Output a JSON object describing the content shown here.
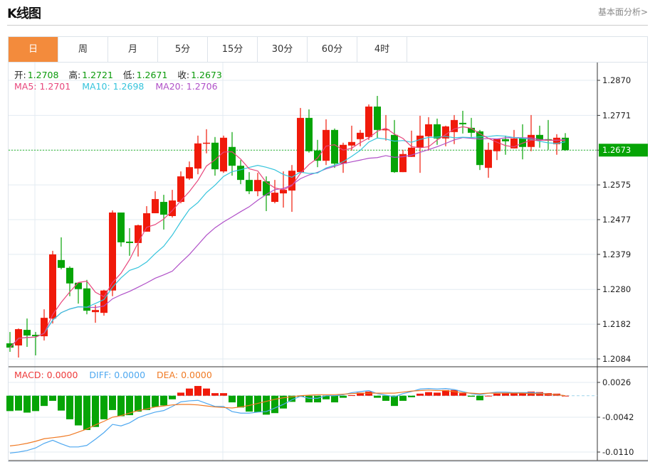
{
  "header": {
    "title": "K线图",
    "fundamental_link": "基本面分析>"
  },
  "tabs": [
    {
      "label": "日",
      "active": true
    },
    {
      "label": "周"
    },
    {
      "label": "月"
    },
    {
      "label": "5分"
    },
    {
      "label": "15分"
    },
    {
      "label": "30分"
    },
    {
      "label": "60分"
    },
    {
      "label": "4时"
    }
  ],
  "legend": {
    "open_label": "开:",
    "open": "1.2708",
    "high_label": "高:",
    "high": "1.2721",
    "low_label": "低:",
    "low": "1.2671",
    "close_label": "收:",
    "close": "1.2673",
    "ma5": "MA5: 1.2701",
    "ma10": "MA10: 1.2698",
    "ma20": "MA20: 1.2706",
    "macd": "MACD: 0.0000",
    "diff": "DIFF: 0.0000",
    "dea": "DEA: 0.0000"
  },
  "colors": {
    "up": "#f01a0a",
    "down": "#06a406",
    "ma5": "#e8467c",
    "ma10": "#35c4dc",
    "ma20": "#b050c8",
    "diff": "#4ea8f0",
    "dea": "#f07a24",
    "accent": "#f38b3c"
  },
  "chart_data": {
    "type": "candlestick",
    "price_axis": {
      "ticks": [
        "1.2870",
        "1.2771",
        "1.2673",
        "1.2575",
        "1.2477",
        "1.2379",
        "1.2280",
        "1.2182",
        "1.2084"
      ],
      "range": [
        1.2084,
        1.287
      ]
    },
    "last_price": "1.2673",
    "macd_axis": {
      "ticks": [
        "0.0026",
        "-0.0042",
        "-0.0110"
      ],
      "range": [
        -0.011,
        0.0026
      ]
    },
    "ohlc": [
      [
        1.2128,
        1.216,
        1.2104,
        1.2116
      ],
      [
        1.2122,
        1.217,
        1.2088,
        1.2168
      ],
      [
        1.2166,
        1.2198,
        1.2118,
        1.215
      ],
      [
        1.2152,
        1.216,
        1.2094,
        1.2148
      ],
      [
        1.2148,
        1.2224,
        1.2136,
        1.22
      ],
      [
        1.2198,
        1.2389,
        1.2184,
        1.2379
      ],
      [
        1.2363,
        1.2427,
        1.2337,
        1.2341
      ],
      [
        1.2341,
        1.2345,
        1.2261,
        1.2297
      ],
      [
        1.2299,
        1.2299,
        1.224,
        1.2281
      ],
      [
        1.2283,
        1.2307,
        1.221,
        1.222
      ],
      [
        1.2216,
        1.2236,
        1.2186,
        1.2222
      ],
      [
        1.2214,
        1.2279,
        1.2206,
        1.2277
      ],
      [
        1.2277,
        1.2503,
        1.2261,
        1.2497
      ],
      [
        1.2497,
        1.2497,
        1.2401,
        1.2413
      ],
      [
        1.2415,
        1.2453,
        1.2375,
        1.2411
      ],
      [
        1.2411,
        1.2463,
        1.2373,
        1.2461
      ],
      [
        1.2443,
        1.2515,
        1.2443,
        1.2495
      ],
      [
        1.2495,
        1.2557,
        1.2495,
        1.2535
      ],
      [
        1.2527,
        1.2547,
        1.2449,
        1.2491
      ],
      [
        1.2487,
        1.2561,
        1.2483,
        1.2531
      ],
      [
        1.2527,
        1.2613,
        1.2523,
        1.2599
      ],
      [
        1.2593,
        1.2641,
        1.2589,
        1.2625
      ],
      [
        1.2621,
        1.2714,
        1.2605,
        1.2692
      ],
      [
        1.2692,
        1.2732,
        1.2664,
        1.2694
      ],
      [
        1.2694,
        1.271,
        1.2601,
        1.2619
      ],
      [
        1.2613,
        1.2714,
        1.2609,
        1.2708
      ],
      [
        1.2682,
        1.2724,
        1.2601,
        1.2629
      ],
      [
        1.2629,
        1.2645,
        1.2577,
        1.2589
      ],
      [
        1.2589,
        1.2611,
        1.2549,
        1.2557
      ],
      [
        1.2557,
        1.2609,
        1.2543,
        1.2589
      ],
      [
        1.2585,
        1.2599,
        1.2501,
        1.2545
      ],
      [
        1.2527,
        1.2589,
        1.2523,
        1.2553
      ],
      [
        1.2551,
        1.2613,
        1.2511,
        1.2561
      ],
      [
        1.2559,
        1.2631,
        1.2499,
        1.2615
      ],
      [
        1.2611,
        1.2792,
        1.2609,
        1.2764
      ],
      [
        1.2764,
        1.2788,
        1.2666,
        1.267
      ],
      [
        1.2672,
        1.2702,
        1.2625,
        1.2643
      ],
      [
        1.2643,
        1.276,
        1.2631,
        1.273
      ],
      [
        1.273,
        1.2734,
        1.2623,
        1.2635
      ],
      [
        1.2635,
        1.2694,
        1.2609,
        1.2688
      ],
      [
        1.2686,
        1.2742,
        1.2672,
        1.2696
      ],
      [
        1.2704,
        1.273,
        1.2684,
        1.2722
      ],
      [
        1.271,
        1.2802,
        1.2702,
        1.2796
      ],
      [
        1.2796,
        1.2826,
        1.2706,
        1.273
      ],
      [
        1.273,
        1.2772,
        1.27,
        1.2732
      ],
      [
        1.2716,
        1.2758,
        1.2609,
        1.2611
      ],
      [
        1.2611,
        1.2674,
        1.2611,
        1.2662
      ],
      [
        1.2654,
        1.2728,
        1.2654,
        1.268
      ],
      [
        1.268,
        1.277,
        1.2609,
        1.2714
      ],
      [
        1.2712,
        1.2766,
        1.2672,
        1.2746
      ],
      [
        1.2746,
        1.2762,
        1.2688,
        1.2706
      ],
      [
        1.2706,
        1.2742,
        1.2684,
        1.274
      ],
      [
        1.2724,
        1.2772,
        1.269,
        1.2758
      ],
      [
        1.275,
        1.2784,
        1.272,
        1.2746
      ],
      [
        1.2736,
        1.2764,
        1.271,
        1.2722
      ],
      [
        1.2726,
        1.273,
        1.2617,
        1.2631
      ],
      [
        1.2623,
        1.2694,
        1.2595,
        1.2674
      ],
      [
        1.267,
        1.2704,
        1.2645,
        1.2704
      ],
      [
        1.2704,
        1.2714,
        1.266,
        1.2698
      ],
      [
        1.2678,
        1.273,
        1.2678,
        1.2706
      ],
      [
        1.2706,
        1.2746,
        1.2647,
        1.2682
      ],
      [
        1.2682,
        1.2772,
        1.267,
        1.2716
      ],
      [
        1.2716,
        1.2742,
        1.268,
        1.2702
      ],
      [
        1.2704,
        1.2758,
        1.2674,
        1.27
      ],
      [
        1.269,
        1.2718,
        1.266,
        1.2708
      ],
      [
        1.2708,
        1.2721,
        1.2671,
        1.2673
      ]
    ],
    "macd_hist": [
      -0.003,
      -0.0029,
      -0.0033,
      -0.003,
      -0.002,
      -0.001,
      -0.0029,
      -0.0046,
      -0.0058,
      -0.0067,
      -0.0061,
      -0.0046,
      -0.0028,
      -0.004,
      -0.0038,
      -0.0031,
      -0.0028,
      -0.0022,
      -0.0019,
      -0.0007,
      0.0006,
      0.0014,
      0.0019,
      0.0014,
      0.0005,
      0.0005,
      -0.0013,
      -0.0023,
      -0.0031,
      -0.0032,
      -0.0037,
      -0.0034,
      -0.0025,
      -0.0012,
      -0.0002,
      -0.0013,
      -0.0013,
      -0.0007,
      -0.0013,
      -0.0004,
      0.0001,
      0.0006,
      0.0008,
      -0.0004,
      -0.001,
      -0.002,
      -0.001,
      -0.0003,
      0.0004,
      0.0007,
      0.0006,
      0.0011,
      0.0011,
      0.0005,
      -0.0002,
      -0.0009,
      0.0,
      0.0004,
      0.0005,
      0.0005,
      0.0005,
      0.0008,
      0.0007,
      0.0005,
      0.0004,
      0.0
    ],
    "diff": [
      -0.0112,
      -0.011,
      -0.0107,
      -0.0102,
      -0.0093,
      -0.0087,
      -0.0094,
      -0.01,
      -0.01,
      -0.0097,
      -0.0085,
      -0.0072,
      -0.0056,
      -0.0059,
      -0.0053,
      -0.0043,
      -0.0037,
      -0.0032,
      -0.0029,
      -0.0021,
      -0.0012,
      -0.001,
      -0.0009,
      -0.0015,
      -0.0021,
      -0.0021,
      -0.0031,
      -0.0034,
      -0.0034,
      -0.0032,
      -0.0031,
      -0.0024,
      -0.0017,
      -0.0008,
      -0.0001,
      -0.0005,
      -0.0005,
      0.0,
      0.0,
      0.0002,
      0.0006,
      0.0008,
      0.001,
      0.0004,
      0.0001,
      -0.0002,
      0.0004,
      0.0008,
      0.0013,
      0.0014,
      0.0013,
      0.0014,
      0.0012,
      0.0008,
      0.0004,
      0.0002,
      0.0005,
      0.0007,
      0.0007,
      0.0006,
      0.0006,
      0.0006,
      0.0005,
      0.0003,
      0.0002,
      0.0
    ],
    "dea": [
      -0.0098,
      -0.0096,
      -0.0093,
      -0.0089,
      -0.0084,
      -0.0082,
      -0.008,
      -0.0077,
      -0.0071,
      -0.0065,
      -0.0057,
      -0.005,
      -0.0042,
      -0.0039,
      -0.0034,
      -0.0029,
      -0.0026,
      -0.0022,
      -0.002,
      -0.0018,
      -0.0017,
      -0.0017,
      -0.0018,
      -0.002,
      -0.0022,
      -0.0023,
      -0.0024,
      -0.0022,
      -0.0019,
      -0.0015,
      -0.0011,
      -0.0007,
      -0.0004,
      -0.0002,
      0.0,
      0.0001,
      0.0002,
      0.0002,
      0.0002,
      0.0003,
      0.0004,
      0.0005,
      0.0005,
      0.0005,
      0.0005,
      0.0005,
      0.0007,
      0.0009,
      0.001,
      0.0011,
      0.001,
      0.001,
      0.0008,
      0.0006,
      0.0005,
      0.0004,
      0.0005,
      0.0005,
      0.0005,
      0.0005,
      0.0005,
      0.0004,
      0.0004,
      0.0003,
      0.0002,
      0.0
    ]
  }
}
